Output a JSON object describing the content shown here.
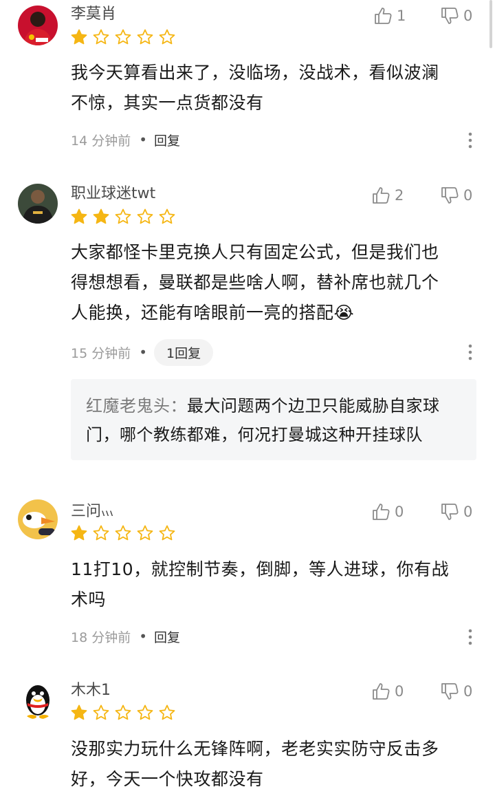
{
  "comments": [
    {
      "username": "李莫肖",
      "rating": 1,
      "text": "我今天算看出来了，没临场，没战术，看似波澜不惊，其实一点货都没有",
      "time": "14 分钟前",
      "reply_label": "回复",
      "likes": "1",
      "dislikes": "0",
      "avatar": "man-utd-player-avatar"
    },
    {
      "username": "职业球迷twt",
      "rating": 2,
      "text": "大家都怪卡里克换人只有固定公式，但是我们也得想想看，曼联都是些啥人啊，替补席也就几个人能换，还能有啥眼前一亮的搭配😭",
      "time": "15 分钟前",
      "reply_label": "1回复",
      "likes": "2",
      "dislikes": "0",
      "avatar": "football-player-avatar",
      "sub_reply": {
        "author": "红魔老鬼头：",
        "text": "最大问题两个边卫只能威胁自家球门，哪个教练都难，何况打曼城这种开挂球队"
      }
    },
    {
      "username": "三问៶៶៶",
      "rating": 1,
      "text": "11打10，就控制节奏，倒脚，等人进球，你有战术吗",
      "time": "18 分钟前",
      "reply_label": "回复",
      "likes": "0",
      "dislikes": "0",
      "avatar": "cartoon-bird-avatar"
    },
    {
      "username": "木木1",
      "rating": 1,
      "text": "没那实力玩什么无锋阵啊，老老实实防守反击多好，今天一个快攻都没有",
      "likes": "0",
      "dislikes": "0",
      "avatar": "qq-penguin-avatar"
    }
  ],
  "colors": {
    "star_filled": "#f5b614",
    "star_empty": "#f5b614",
    "muted_text": "#9a9a9a",
    "reply_bg": "#f5f6f7"
  }
}
